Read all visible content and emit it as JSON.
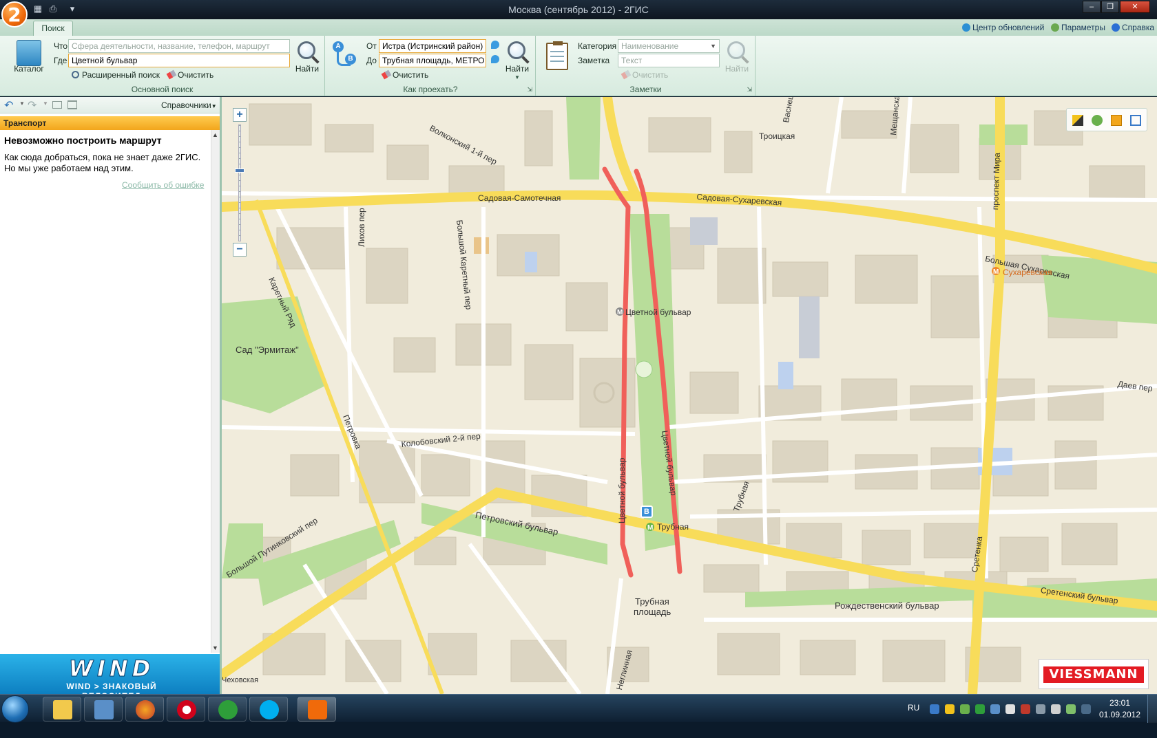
{
  "window": {
    "title": "Москва (сентябрь 2012) - 2ГИС",
    "app_icon": "2"
  },
  "topbar": {
    "tab_search": "Поиск",
    "update_center": "Центр обновлений",
    "params": "Параметры",
    "help": "Справка"
  },
  "search": {
    "catalog_label": "Каталог",
    "what_label": "Что",
    "what_placeholder": "Сфера деятельности, название, телефон, маршрут",
    "where_label": "Где",
    "where_value": "Цветной бульвар",
    "find_label": "Найти",
    "advanced_label": "Расширенный поиск",
    "clear_label": "Очистить",
    "group_label": "Основной поиск"
  },
  "route": {
    "from_label": "От",
    "from_value": "Истра (Истринский район)",
    "to_label": "До",
    "to_value": "Трубная площадь, МЕТРО ВХОД",
    "clear_label": "Очистить",
    "find_label": "Найти",
    "group_label": "Как проехать?"
  },
  "notes": {
    "category_label": "Категория",
    "category_placeholder": "Наименование",
    "note_label": "Заметка",
    "note_placeholder": "Текст",
    "clear_label": "Очистить",
    "find_label": "Найти",
    "group_label": "Заметки"
  },
  "leftpanel": {
    "directories": "Справочники",
    "section": "Транспорт",
    "heading": "Невозможно построить маршрут",
    "line1": "Как сюда добраться, пока не знает даже 2ГИС.",
    "line2": "Но мы уже работаем над этим.",
    "report_link": "Сообщить об ошибке",
    "banner_brand": "WIND",
    "banner_slogan": "WIND > ЗНАКОВЫЙ ВЕЛОСИПЕД"
  },
  "map": {
    "labels": {
      "volkonsky": "Волконский 1-й пер",
      "troitskaya": "Троицкая",
      "vasnetsova": "Васнец",
      "meshchanskaya": "Мещанска",
      "prospekt_mira": "проспект Мира",
      "sadovaya_samotechnaya": "Садовая-Самотечная",
      "sadovaya_sukharevskaya": "Садовая-Сухаревская",
      "bolshaya_sukharevskaya": "Большая Сухаревская",
      "sukharevskaya_metro": "Сухаревская",
      "bolshoy_karetny": "Большой Каретный пер",
      "likhov": "Лихов пер",
      "karetny_ryad": "Каретный Ряд",
      "tsvetnoy_metro": "Цветной бульвар",
      "sad_ermitazh": "Сад \"Эрмитаж\"",
      "petrovka": "Петровка",
      "kolobovsky": "Колобовский 2-й пер",
      "tsvetnoy_bulvar_w": "Цветной бульвар",
      "tsvetnoy_bulvar_e": "Цветной бульвар",
      "trubnaya_st": "Трубная",
      "trubnaya_ploshchad_1": "Трубная",
      "trubnaya_ploshchad_2": "площадь",
      "trubnaya_metro": "Трубная",
      "petrovsky_bulvar": "Петровский бульвар",
      "putinkovsky": "Большой Путинковский пер",
      "rozhdestvensky": "Рождественский бульвар",
      "sretenka": "Сретенка",
      "sretensky_bulvar": "Сретенский бульвар",
      "daev": "Даев пер",
      "neglinnaya": "Неглинная",
      "chekhovskaya": "Чеховская",
      "marker_b": "B"
    },
    "zoom_in": "+",
    "zoom_out": "−",
    "ad_brand": "VIESSMANN"
  },
  "taskbar": {
    "lang": "RU",
    "time": "23:01",
    "date": "01.09.2012"
  },
  "colors": {
    "ribbon": "#d7ebdf",
    "route": "#f0605a",
    "major_road": "#f8dc5a",
    "park": "#b8dd9a",
    "accent_orange": "#f2a61c"
  }
}
